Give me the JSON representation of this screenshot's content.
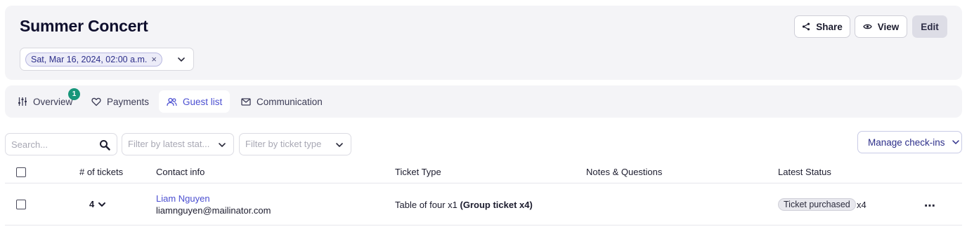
{
  "event": {
    "title": "Summer Concert",
    "date_chip": "Sat, Mar 16, 2024, 02:00 a.m.",
    "actions": {
      "share": "Share",
      "view": "View",
      "edit": "Edit"
    }
  },
  "tabs": [
    {
      "label": "Overview",
      "icon": "sliders-icon",
      "badge": "1"
    },
    {
      "label": "Payments",
      "icon": "heart-icon"
    },
    {
      "label": "Guest list",
      "icon": "users-icon",
      "active": true
    },
    {
      "label": "Communication",
      "icon": "mail-icon"
    }
  ],
  "filters": {
    "search_placeholder": "Search...",
    "status_placeholder": "Filter by latest stat...",
    "ticket_placeholder": "Filter by ticket type",
    "manage_label": "Manage check-ins"
  },
  "table": {
    "columns": [
      "# of tickets",
      "Contact info",
      "Ticket Type",
      "Notes & Questions",
      "Latest Status"
    ],
    "rows": [
      {
        "tickets": "4",
        "name": "Liam Nguyen",
        "email": "liamnguyen@mailinator.com",
        "ticket_type": "Table of four x1",
        "ticket_group": "(Group ticket x4)",
        "notes": "",
        "status": "Ticket purchased",
        "status_count": "x4"
      }
    ]
  },
  "colors": {
    "accent": "#4b4fd1",
    "badge": "#17967a",
    "panel": "#f4f4f7"
  }
}
